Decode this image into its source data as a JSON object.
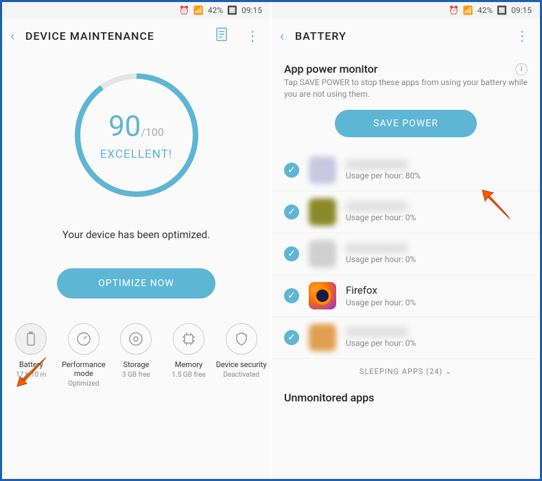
{
  "status": {
    "battery_pct": "42%",
    "time": "09:15"
  },
  "left": {
    "title": "DEVICE MAINTENANCE",
    "score": "90",
    "score_max": "/100",
    "score_label": "EXCELLENT!",
    "optimized_msg": "Your device has been optimized.",
    "optimize_btn": "OPTIMIZE NOW",
    "tabs": [
      {
        "label": "Battery",
        "sub": "17 h 10 m"
      },
      {
        "label": "Performance mode",
        "sub": "Optimized"
      },
      {
        "label": "Storage",
        "sub": "3 GB free"
      },
      {
        "label": "Memory",
        "sub": "1.5 GB free"
      },
      {
        "label": "Device security",
        "sub": "Deactivated"
      }
    ]
  },
  "right": {
    "title": "BATTERY",
    "section_title": "App power monitor",
    "section_sub": "Tap SAVE POWER to stop these apps from using your battery while you are not using them.",
    "save_btn": "SAVE POWER",
    "apps": [
      {
        "name": "",
        "usage": "Usage per hour: 80%",
        "blurred": true,
        "icon_bg": "#c8c8e0"
      },
      {
        "name": "",
        "usage": "Usage per hour: 0%",
        "blurred": true,
        "icon_bg": "#8a8a2a"
      },
      {
        "name": "",
        "usage": "Usage per hour: 0%",
        "blurred": true,
        "icon_bg": "#d0d0d0"
      },
      {
        "name": "Firefox",
        "usage": "Usage per hour: 0%",
        "blurred": false,
        "icon_bg": "firefox"
      },
      {
        "name": "",
        "usage": "Usage per hour: 0%",
        "blurred": true,
        "icon_bg": "#e0a050"
      }
    ],
    "sleeping": "SLEEPING APPS (24)",
    "unmonitored": "Unmonitored apps"
  }
}
